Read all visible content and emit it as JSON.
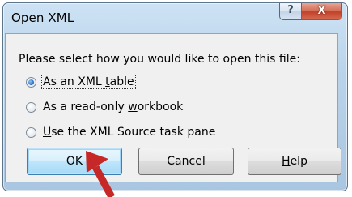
{
  "window": {
    "title": "Open XML",
    "help_glyph": "?",
    "close_glyph": "X",
    "prompt": "Please select how you would like to open this file:"
  },
  "options": [
    {
      "prefix": "As an XML ",
      "mnemonic": "t",
      "suffix": "able",
      "selected": true
    },
    {
      "prefix": "As a read-only ",
      "mnemonic": "w",
      "suffix": "orkbook",
      "selected": false
    },
    {
      "prefix": "",
      "mnemonic": "U",
      "suffix": "se the XML Source task pane",
      "selected": false
    }
  ],
  "buttons": {
    "ok": "OK",
    "cancel": "Cancel",
    "help_mnemonic": "H",
    "help_rest": "elp"
  },
  "icons": {
    "help": "help-icon",
    "close": "close-icon",
    "pointer": "red-arrow-pointer-icon"
  },
  "colors": {
    "frame": "#b9d3ea",
    "close_button": "#c2412b",
    "default_button": "#bee6fd",
    "pointer": "#c62828"
  }
}
